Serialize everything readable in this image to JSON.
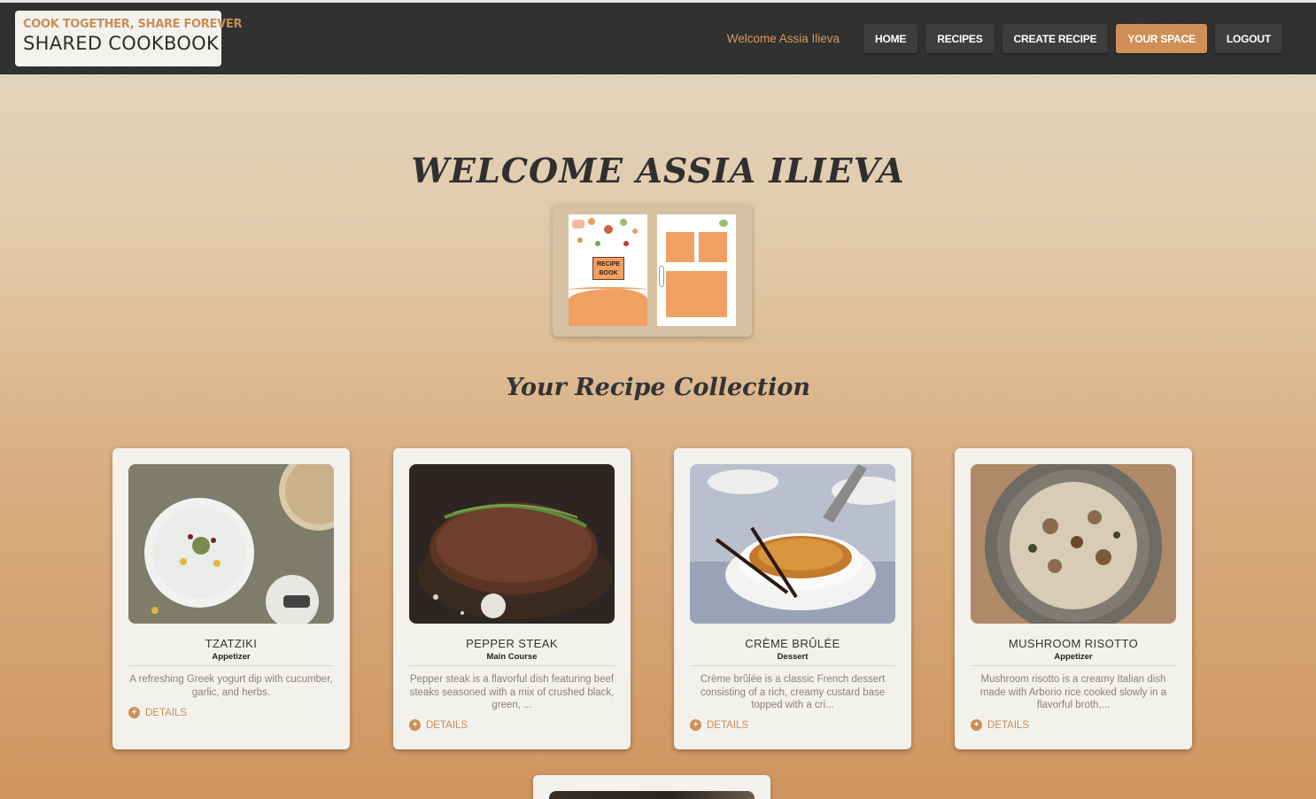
{
  "header": {
    "logo_tagline": "COOK TOGETHER, SHARE FOREVER",
    "logo_name": "SHARED COOKBOOK",
    "welcome": "Welcome Assia Ilieva",
    "nav": [
      "HOME",
      "RECIPES",
      "CREATE RECIPE",
      "YOUR SPACE",
      "LOGOUT"
    ],
    "active_nav": "YOUR SPACE"
  },
  "hero": {
    "title": "WELCOME ASSIA ILIEVA",
    "book_label": "RECIPE BOOK"
  },
  "collection": {
    "title": "Your Recipe Collection",
    "recipes": [
      {
        "name": "TZATZIKI",
        "category": "Appetizer",
        "description": "A refreshing Greek yogurt dip with cucumber, garlic, and herbs.",
        "details": "DETAILS"
      },
      {
        "name": "PEPPER STEAK",
        "category": "Main Course",
        "description": "Pepper steak is a flavorful dish featuring beef steaks seasoned with a mix of crushed black, green, ...",
        "details": "DETAILS"
      },
      {
        "name": "CRÈME BRÛLÉE",
        "category": "Dessert",
        "description": "Crème brûlée is a classic French dessert consisting of a rich, creamy custard base topped with a cri...",
        "details": "DETAILS"
      },
      {
        "name": "MUSHROOM RISOTTO",
        "category": "Appetizer",
        "description": "Mushroom risotto is a creamy Italian dish made with Arborio rice cooked slowly in a flavorful broth,...",
        "details": "DETAILS"
      }
    ]
  },
  "colors": {
    "accent": "#cf8f56",
    "header_bg": "#2f2f2f",
    "card_bg": "#f2f1ec"
  }
}
